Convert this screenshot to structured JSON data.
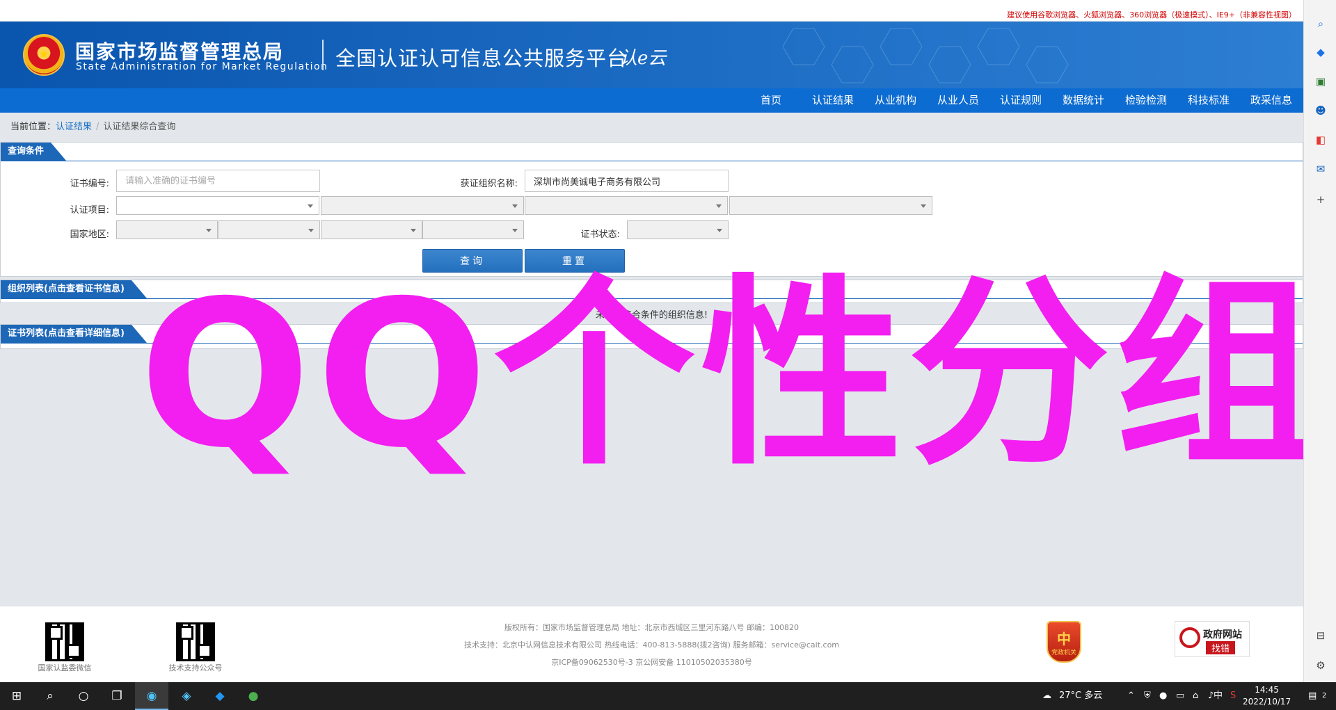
{
  "notice": "建议使用谷歌浏览器、火狐浏览器、360浏览器（极速模式）、IE9+（非兼容性视图）",
  "header": {
    "org_cn": "国家市场监督管理总局",
    "org_en": "State Administration  for  Market Regulation",
    "platform": "全国认证认可信息公共服务平台",
    "brand_logo": "认e云"
  },
  "nav": {
    "items": [
      "首页",
      "认证结果",
      "从业机构",
      "从业人员",
      "认证规则",
      "数据统计",
      "检验检测",
      "科技标准",
      "政采信息"
    ]
  },
  "breadcrumb": {
    "prefix": "当前位置：",
    "link": "认证结果",
    "separator": "/",
    "current": "认证结果综合查询"
  },
  "query": {
    "title": "查询条件",
    "cert_no_label": "证书编号:",
    "cert_no_placeholder": "请输入准确的证书编号",
    "org_name_label": "获证组织名称:",
    "org_name_value": "深圳市尚美诚电子商务有限公司",
    "project_label": "认证项目:",
    "region_label": "国家地区:",
    "status_label": "证书状态:",
    "search_button": "查询",
    "reset_button": "重置"
  },
  "org_list": {
    "title": "组织列表(点击查看证书信息)",
    "empty_message": "未查到符合条件的组织信息!"
  },
  "cert_list": {
    "title": "证书列表(点击查看详细信息)"
  },
  "watermark": "QQ个性分组",
  "footer": {
    "qr1_label": "国家认监委微信",
    "qr2_label": "技术支持公众号",
    "line1": "版权所有：国家市场监督管理总局   地址：北京市西城区三里河东路八号   邮编：100820",
    "line2": "技术支持：北京中认网信息技术有限公司   热线电话：400-813-5888(拨2咨询)   服务邮箱：service@cait.com",
    "line3": "京ICP备09062530号-3    京公网安备   11010502035380号",
    "police_badge": "党政机关",
    "gov_badge_title": "政府网站",
    "gov_badge_action": "找错"
  },
  "taskbar": {
    "weather": "27°C  多云",
    "ime": "中",
    "time": "14:45",
    "date": "2022/10/17",
    "notify_count": "2"
  },
  "colors": {
    "brand_blue": "#0d6cd1",
    "panel_blue": "#1d67b8",
    "watermark_magenta": "#f31ef0",
    "notice_red": "#d20000"
  }
}
